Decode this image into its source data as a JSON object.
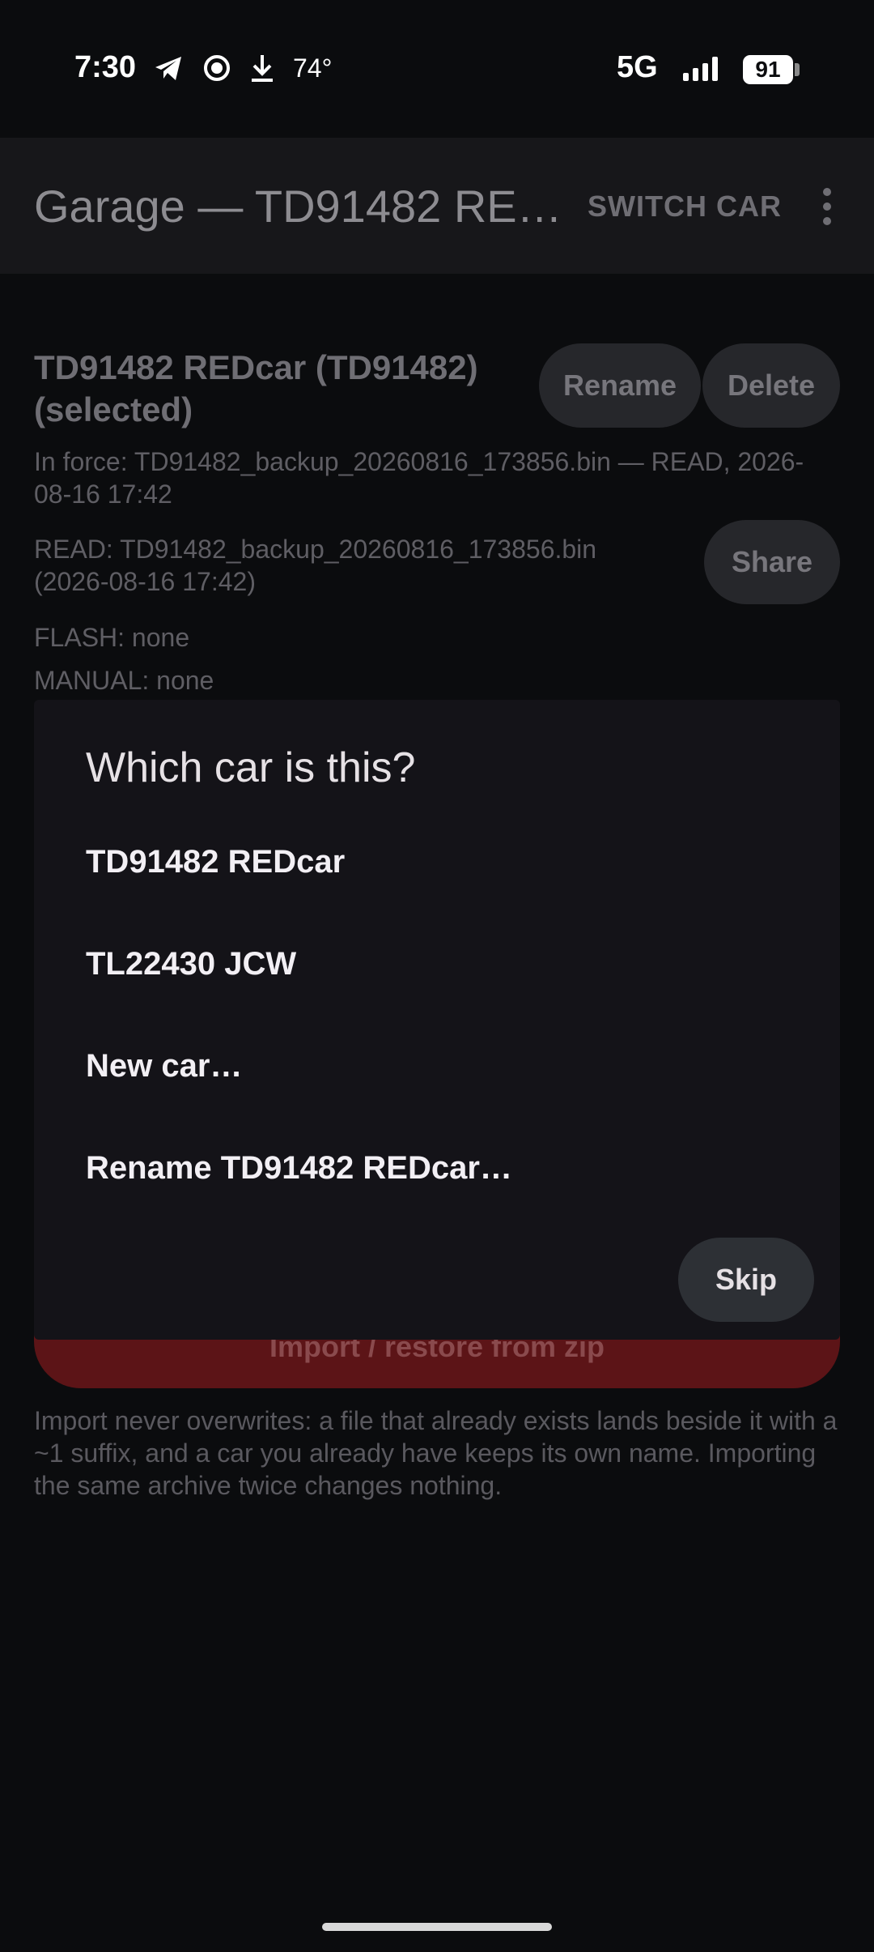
{
  "status_bar": {
    "time": "7:30",
    "temperature": "74°",
    "network": "5G",
    "battery": "91",
    "icons": [
      "telegram-icon",
      "record-icon",
      "download-icon",
      "signal-icon",
      "battery-icon"
    ]
  },
  "app_bar": {
    "title": "Garage — TD91482 RE…",
    "switch_car_label": "SWITCH CAR",
    "menu_icon": "more-vert-icon"
  },
  "car": {
    "title": "TD91482 REDcar  (TD91482) (selected)",
    "rename_label": "Rename",
    "delete_label": "Delete",
    "in_force": "In force: TD91482_backup_20260816_173856.bin — READ, 2026-08-16 17:42",
    "read": "READ: TD91482_backup_20260816_173856.bin (2026-08-16 17:42)",
    "share_label": "Share",
    "flash": "FLASH: none",
    "manual": "MANUAL: none"
  },
  "import": {
    "button_label": "Import / restore from zip",
    "note": "Import never overwrites: a file that already exists lands beside it with a ~1 suffix, and a car you already have keeps its own name. Importing the same archive twice changes nothing."
  },
  "dialog": {
    "title": "Which car is this?",
    "options": [
      "TD91482 REDcar",
      "TL22430 JCW",
      "New car…",
      "Rename TD91482 REDcar…"
    ],
    "skip_label": "Skip"
  },
  "colors": {
    "background": "#0b0c0e",
    "dialog": "#141318",
    "import_button": "#5c1417",
    "pill_button": "#26272b"
  }
}
